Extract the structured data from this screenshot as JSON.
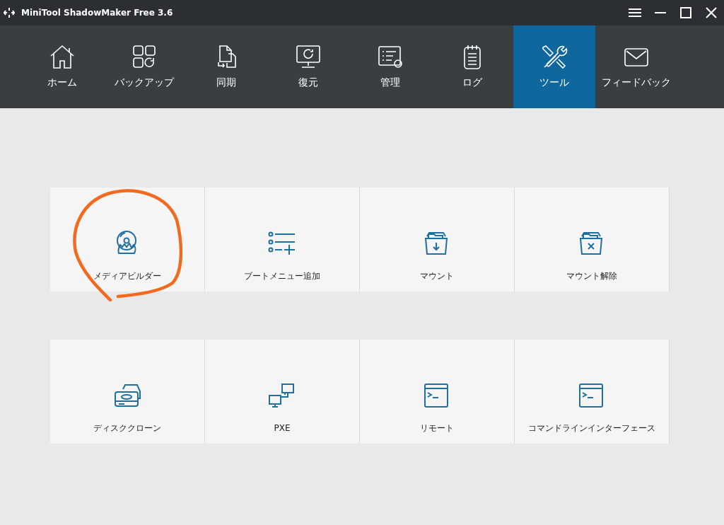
{
  "window": {
    "title": "MiniTool ShadowMaker Free 3.6"
  },
  "tabs": [
    {
      "label": "ホーム",
      "selected": false
    },
    {
      "label": "バックアップ",
      "selected": false
    },
    {
      "label": "同期",
      "selected": false
    },
    {
      "label": "復元",
      "selected": false
    },
    {
      "label": "管理",
      "selected": false
    },
    {
      "label": "ログ",
      "selected": false
    },
    {
      "label": "ツール",
      "selected": true
    },
    {
      "label": "フィードバック",
      "selected": false
    }
  ],
  "tools": [
    [
      {
        "label": "メディアビルダー"
      },
      {
        "label": "ブートメニュー追加"
      },
      {
        "label": "マウント"
      },
      {
        "label": "マウント解除"
      }
    ],
    [
      {
        "label": "ディスククローン"
      },
      {
        "label": "PXE"
      },
      {
        "label": "リモート"
      },
      {
        "label": "コマンドラインインターフェース"
      }
    ]
  ]
}
